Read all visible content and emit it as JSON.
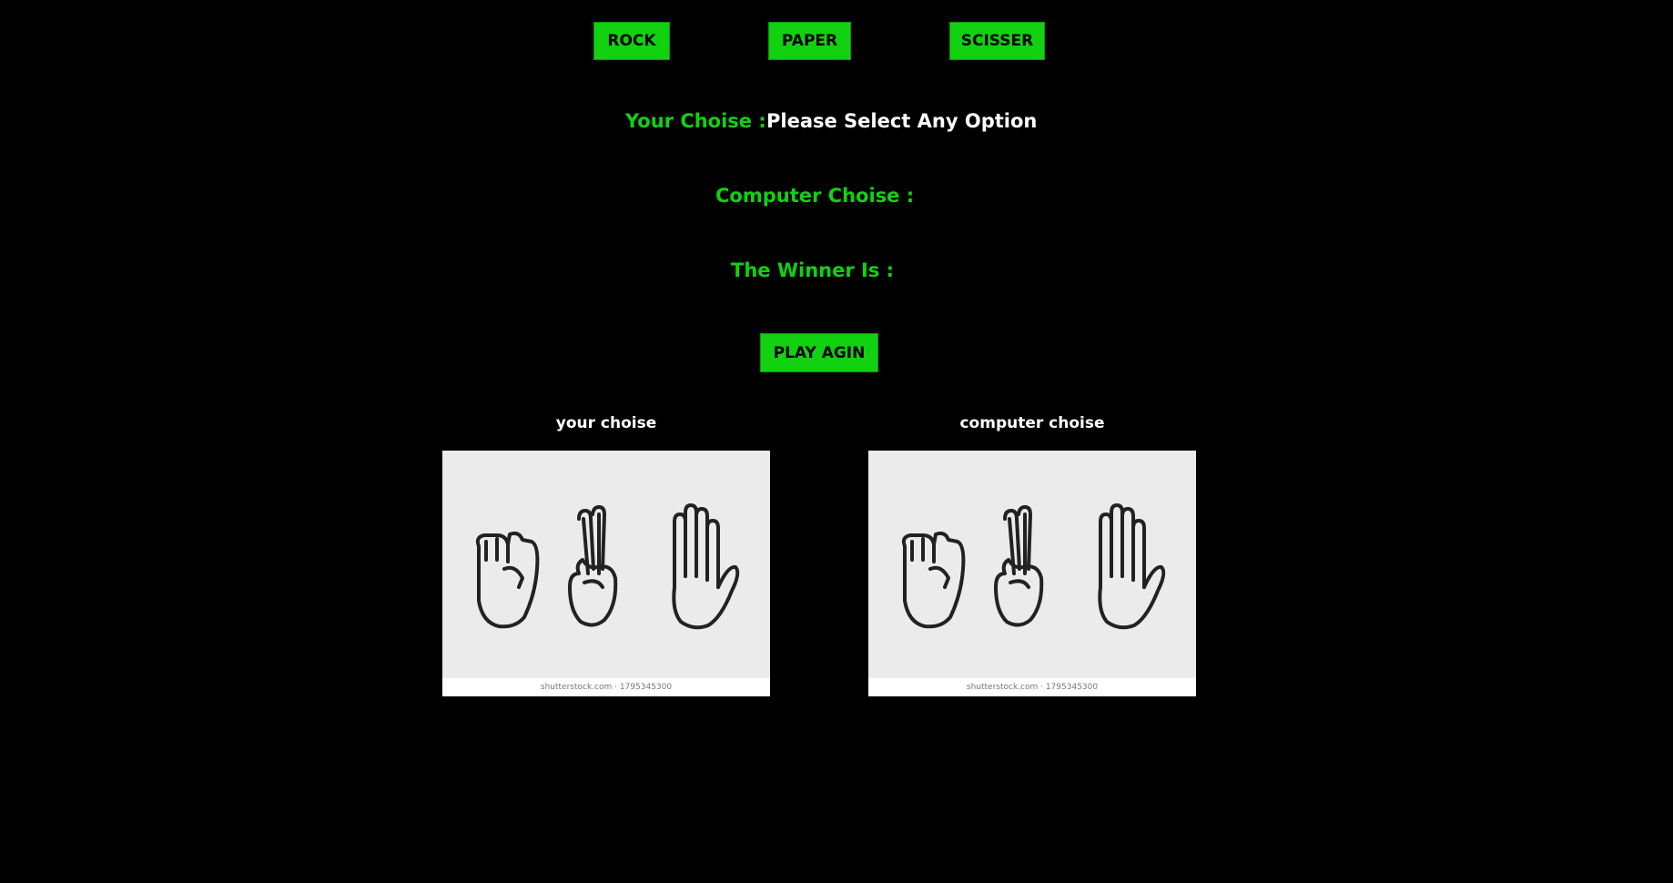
{
  "buttons": {
    "rock": "ROCK",
    "paper": "PAPER",
    "scissor": "SCISSER",
    "play_again": "PLAY AGIN"
  },
  "results": {
    "your_choice_label": "Your Choise :",
    "your_choice_value": "Please Select Any Option",
    "computer_choice_label": "Computer Choise :",
    "computer_choice_value": "",
    "winner_label": "The Winner Is :",
    "winner_value": ""
  },
  "images": {
    "your_caption": "your choise",
    "computer_caption": "computer choise",
    "watermark": "shutterstock.com · 1795345300"
  },
  "colors": {
    "background": "#000000",
    "accent_green": "#11d111",
    "text_white": "#ffffff",
    "image_bg": "#ebebeb"
  }
}
